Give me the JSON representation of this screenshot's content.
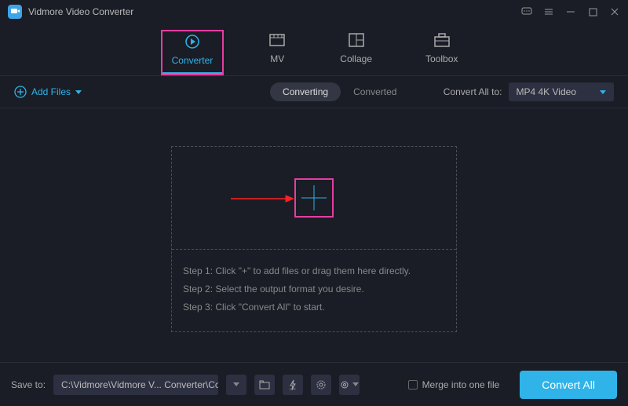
{
  "app_title": "Vidmore Video Converter",
  "tabs": {
    "converter": "Converter",
    "mv": "MV",
    "collage": "Collage",
    "toolbox": "Toolbox"
  },
  "subbar": {
    "add_files": "Add Files",
    "converting": "Converting",
    "converted": "Converted",
    "convert_all_to": "Convert All to:",
    "format": "MP4 4K Video"
  },
  "steps": {
    "s1": "Step 1: Click \"+\" to add files or drag them here directly.",
    "s2": "Step 2: Select the output format you desire.",
    "s3": "Step 3: Click \"Convert All\" to start."
  },
  "footer": {
    "save_to": "Save to:",
    "path": "C:\\Vidmore\\Vidmore V... Converter\\Converted",
    "merge": "Merge into one file",
    "convert_all": "Convert All"
  }
}
